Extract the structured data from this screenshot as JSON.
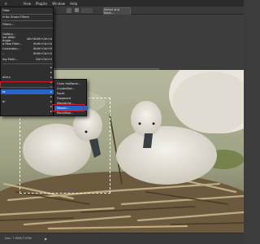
{
  "menubar": {
    "items": [
      "e",
      "View",
      "Plugins",
      "Window",
      "Help"
    ]
  },
  "options": {
    "select_mask_label": "Select and Mask..."
  },
  "filter_menu": {
    "items": [
      {
        "label": "Filter",
        "shortcut": ""
      },
      {
        "label": "rt for Smart Filters",
        "shortcut": ""
      },
      {
        "label": "Filters...",
        "shortcut": ""
      },
      {
        "label": "Gallery...",
        "shortcut": ""
      },
      {
        "label": "ive Wide Angle...",
        "shortcut": "Alt+Shift+Ctrl+A"
      },
      {
        "label": "a Raw Filter...",
        "shortcut": "Shift+Ctrl+A"
      },
      {
        "label": "Correction...",
        "shortcut": "Shift+Ctrl+R"
      },
      {
        "label": "...",
        "shortcut": "Shift+Ctrl+X"
      },
      {
        "label": "ing Point...",
        "shortcut": "Alt+Ctrl+V"
      },
      {
        "label": "",
        "shortcut": ""
      },
      {
        "label": "",
        "shortcut": ""
      },
      {
        "label": "allery",
        "shortcut": ""
      },
      {
        "label": "",
        "shortcut": ""
      },
      {
        "label": "",
        "shortcut": ""
      },
      {
        "label": "te",
        "shortcut": ""
      },
      {
        "label": "",
        "shortcut": ""
      },
      {
        "label": "er",
        "shortcut": ""
      },
      {
        "label": "",
        "shortcut": ""
      },
      {
        "label": "",
        "shortcut": ""
      }
    ],
    "highlighted_index": 14
  },
  "pixelate_submenu": {
    "items": [
      "Color Halftone...",
      "Crystallize...",
      "Facet",
      "Fragment",
      "Mezzotint...",
      "Mosaic...",
      "Pointillize..."
    ],
    "highlighted_index": 5
  },
  "status": {
    "left": "Doc: 7.05M/7.05M"
  },
  "colors": {
    "accent": "#2666c8",
    "highlight_outline": "#d01c1c"
  }
}
